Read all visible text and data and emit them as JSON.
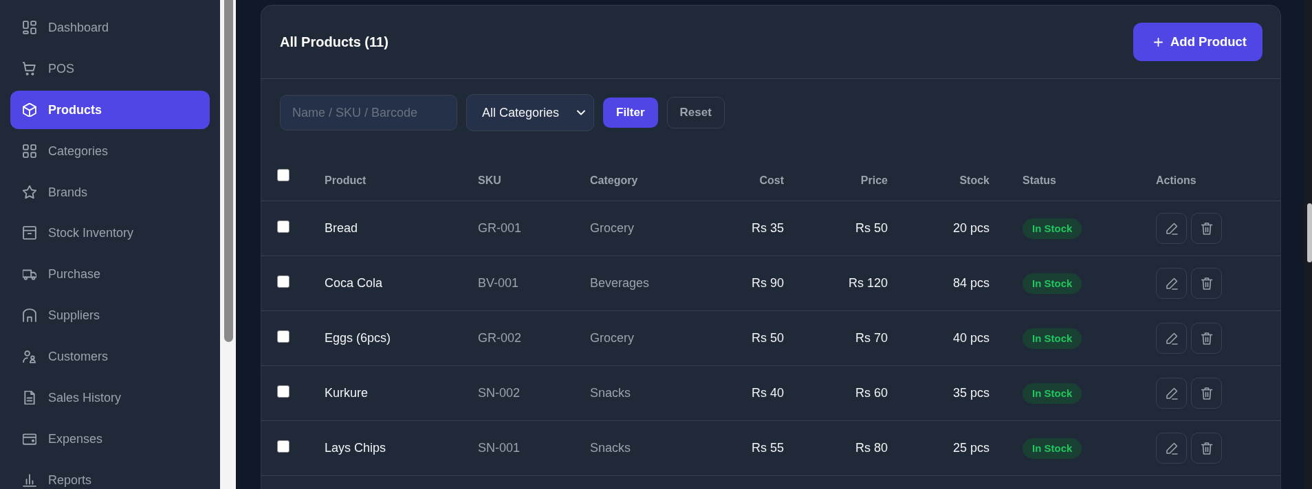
{
  "sidebar": {
    "items": [
      {
        "label": "Dashboard",
        "selected": false
      },
      {
        "label": "POS",
        "selected": false
      },
      {
        "label": "Products",
        "selected": true
      },
      {
        "label": "Categories",
        "selected": false
      },
      {
        "label": "Brands",
        "selected": false
      },
      {
        "label": "Stock Inventory",
        "selected": false
      },
      {
        "label": "Purchase",
        "selected": false
      },
      {
        "label": "Suppliers",
        "selected": false
      },
      {
        "label": "Customers",
        "selected": false
      },
      {
        "label": "Sales History",
        "selected": false
      },
      {
        "label": "Expenses",
        "selected": false
      },
      {
        "label": "Reports",
        "selected": false
      }
    ]
  },
  "card": {
    "title": "All Products (11)",
    "add_button": "Add Product"
  },
  "filters": {
    "search": {
      "placeholder": "Name / SKU / Barcode"
    },
    "category": {
      "value": "All Categories"
    },
    "buttons": [
      {
        "label": "Filter",
        "kind": "primary"
      },
      {
        "label": "Reset",
        "kind": "secondary"
      }
    ]
  },
  "table": {
    "select_all": {
      "checked": false
    },
    "columns": [
      "Product",
      "SKU",
      "Category",
      "Cost",
      "Price",
      "Stock",
      "Status",
      "Actions"
    ],
    "rows": [
      {
        "checked": false,
        "product": "Bread",
        "sku": "GR-001",
        "category": "Grocery",
        "cost": "Rs 35",
        "price": "Rs 50",
        "stock": "20 pcs",
        "status": "In Stock"
      },
      {
        "checked": false,
        "product": "Coca Cola",
        "sku": "BV-001",
        "category": "Beverages",
        "cost": "Rs 90",
        "price": "Rs 120",
        "stock": "84 pcs",
        "status": "In Stock"
      },
      {
        "checked": false,
        "product": "Eggs (6pcs)",
        "sku": "GR-002",
        "category": "Grocery",
        "cost": "Rs 50",
        "price": "Rs 70",
        "stock": "40 pcs",
        "status": "In Stock"
      },
      {
        "checked": false,
        "product": "Kurkure",
        "sku": "SN-002",
        "category": "Snacks",
        "cost": "Rs 40",
        "price": "Rs 60",
        "stock": "35 pcs",
        "status": "In Stock"
      },
      {
        "checked": false,
        "product": "Lays Chips",
        "sku": "SN-001",
        "category": "Snacks",
        "cost": "Rs 55",
        "price": "Rs 80",
        "stock": "25 pcs",
        "status": "In Stock"
      }
    ]
  }
}
